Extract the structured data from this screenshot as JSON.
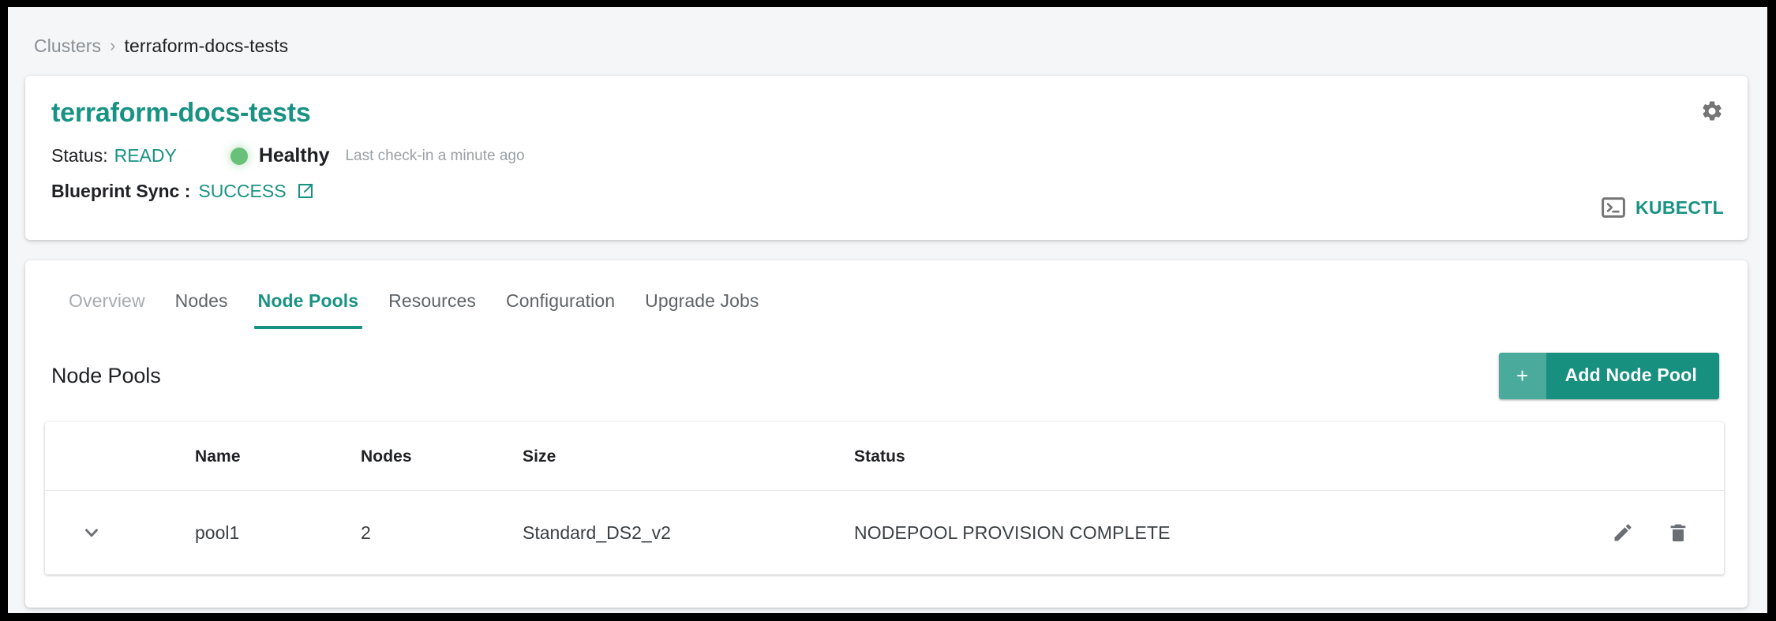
{
  "breadcrumb": {
    "root": "Clusters",
    "separator": "›",
    "current": "terraform-docs-tests"
  },
  "header": {
    "title": "terraform-docs-tests",
    "status_label": "Status:",
    "status_value": "READY",
    "health_text": "Healthy",
    "health_dot_color": "#68c178",
    "checkin_text": "Last check-in a minute ago",
    "sync_label": "Blueprint Sync :",
    "sync_value": "SUCCESS",
    "sync_link_icon": "external-link-icon",
    "settings_icon": "gear-icon",
    "kubectl_icon": "terminal-icon",
    "kubectl_label": "KUBECTL"
  },
  "tabs": [
    {
      "label": "Overview",
      "state": "dim"
    },
    {
      "label": "Nodes",
      "state": "normal"
    },
    {
      "label": "Node Pools",
      "state": "active"
    },
    {
      "label": "Resources",
      "state": "normal"
    },
    {
      "label": "Configuration",
      "state": "normal"
    },
    {
      "label": "Upgrade Jobs",
      "state": "normal"
    }
  ],
  "section": {
    "title": "Node Pools",
    "add_button_plus": "+",
    "add_button_label": "Add Node Pool"
  },
  "table": {
    "columns": [
      "",
      "Name",
      "Nodes",
      "Size",
      "Status",
      ""
    ],
    "rows": [
      {
        "toggle_icon": "chevron-down-icon",
        "name": "pool1",
        "nodes": "2",
        "size": "Standard_DS2_v2",
        "status": "NODEPOOL PROVISION COMPLETE",
        "edit_icon": "pencil-icon",
        "delete_icon": "trash-icon"
      }
    ]
  },
  "colors": {
    "accent_teal": "#189383",
    "accent_teal_dark": "#17907f",
    "accent_teal_light": "#4aab9c",
    "health_green": "#68c178",
    "page_bg": "#f4f6f8",
    "text_primary": "#202124",
    "text_muted": "#9aa0a6"
  }
}
